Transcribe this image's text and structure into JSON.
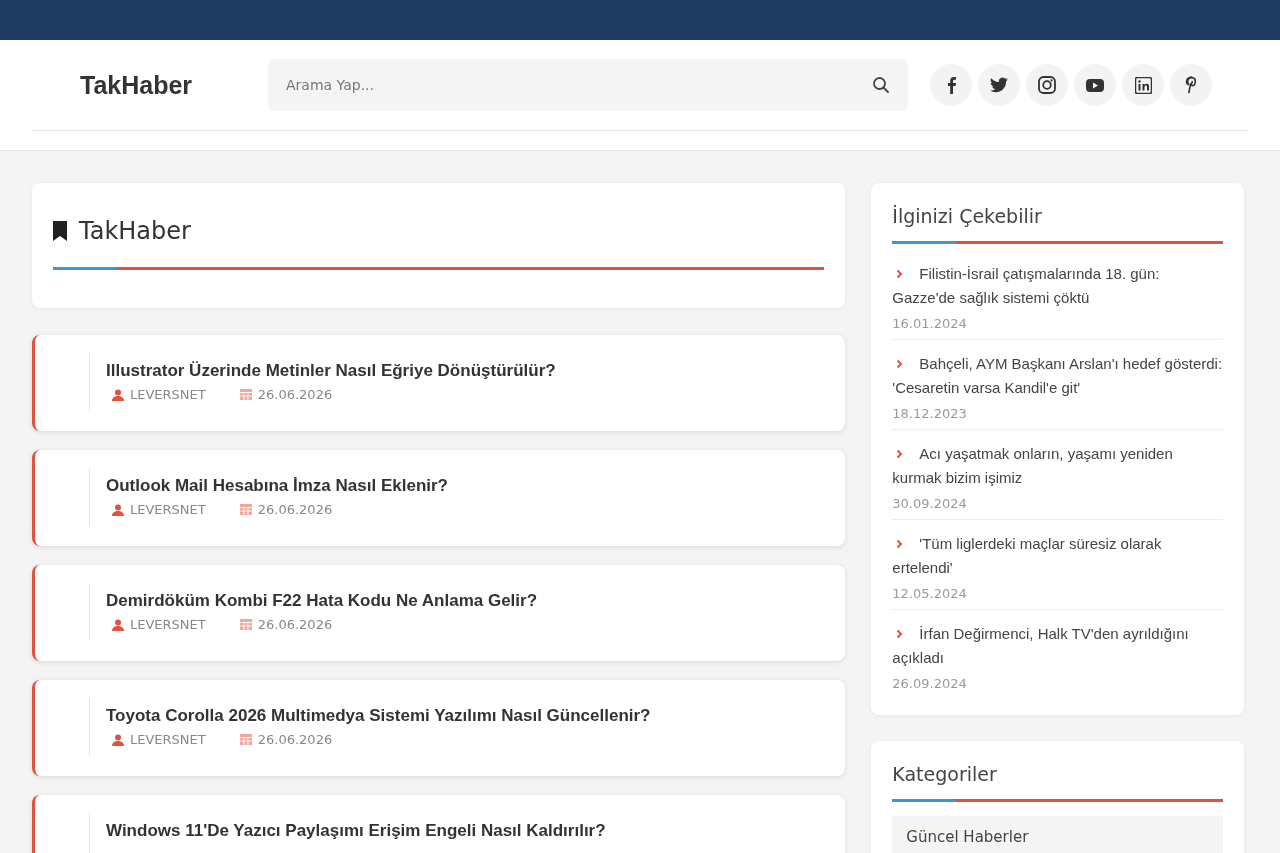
{
  "header": {
    "logo": "TakHaber",
    "search": {
      "placeholder": "Arama Yap..."
    }
  },
  "main": {
    "title": "TakHaber",
    "posts": [
      {
        "title": "Illustrator Üzerinde Metinler Nasıl Eğriye Dönüştürülür?",
        "author": "LEVERSNET",
        "date": "26.06.2026"
      },
      {
        "title": "Outlook Mail Hesabına İmza Nasıl Eklenir?",
        "author": "LEVERSNET",
        "date": "26.06.2026"
      },
      {
        "title": "Demirdöküm Kombi F22 Hata Kodu Ne Anlama Gelir?",
        "author": "LEVERSNET",
        "date": "26.06.2026"
      },
      {
        "title": "Toyota Corolla 2026 Multimedya Sistemi Yazılımı Nasıl Güncellenir?",
        "author": "LEVERSNET",
        "date": "26.06.2026"
      },
      {
        "title": "Windows 11'De Yazıcı Paylaşımı Erişim Engeli Nasıl Kaldırılır?"
      }
    ]
  },
  "sidebar": {
    "widgets": [
      {
        "kind": "news",
        "title": "İlginizi Çekebilir",
        "items": [
          {
            "title": "Filistin-İsrail çatışmalarında 18. gün: Gazze'de sağlık sistemi çöktü",
            "date": "16.01.2024"
          },
          {
            "title": "Bahçeli, AYM Başkanı Arslan'ı hedef gösterdi: 'Cesaretin varsa Kandil'e git'",
            "date": "18.12.2023"
          },
          {
            "title": "Acı yaşatmak onların, yaşamı yeniden kurmak bizim işimiz",
            "date": "30.09.2024"
          },
          {
            "title": "'Tüm liglerdeki maçlar süresiz olarak ertelendi'",
            "date": "12.05.2024"
          },
          {
            "title": "İrfan Değirmenci, Halk TV'den ayrıldığını açıkladı",
            "date": "26.09.2024"
          }
        ]
      },
      {
        "kind": "categories",
        "title": "Kategoriler",
        "items": [
          {
            "title": "Güncel Haberler"
          }
        ]
      }
    ]
  }
}
